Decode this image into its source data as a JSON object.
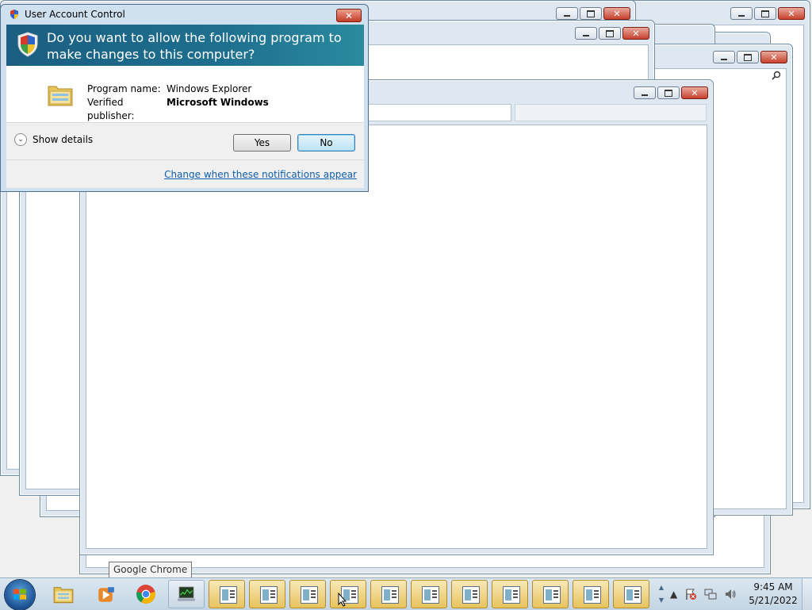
{
  "uac": {
    "title": "User Account Control",
    "close_label": "✕",
    "question": "Do you want to allow the following program to make changes to this computer?",
    "program_label": "Program name:",
    "program_value": "Windows Explorer",
    "publisher_label": "Verified publisher:",
    "publisher_value": "Microsoft Windows",
    "show_details": "Show details",
    "yes_label": "Yes",
    "no_label": "No",
    "notifications_link": "Change when these notifications appear"
  },
  "tooltip": {
    "text": "Google Chrome"
  },
  "taskbar": {
    "pinned": [
      {
        "name": "windows-explorer",
        "icon": "folder-icon"
      },
      {
        "name": "media-player",
        "icon": "media-player-icon"
      },
      {
        "name": "google-chrome",
        "icon": "chrome-icon"
      },
      {
        "name": "task-manager",
        "icon": "monitor-icon"
      }
    ],
    "open_windows_count": 11,
    "clock_time": "9:45 AM",
    "clock_date": "5/21/2022"
  }
}
